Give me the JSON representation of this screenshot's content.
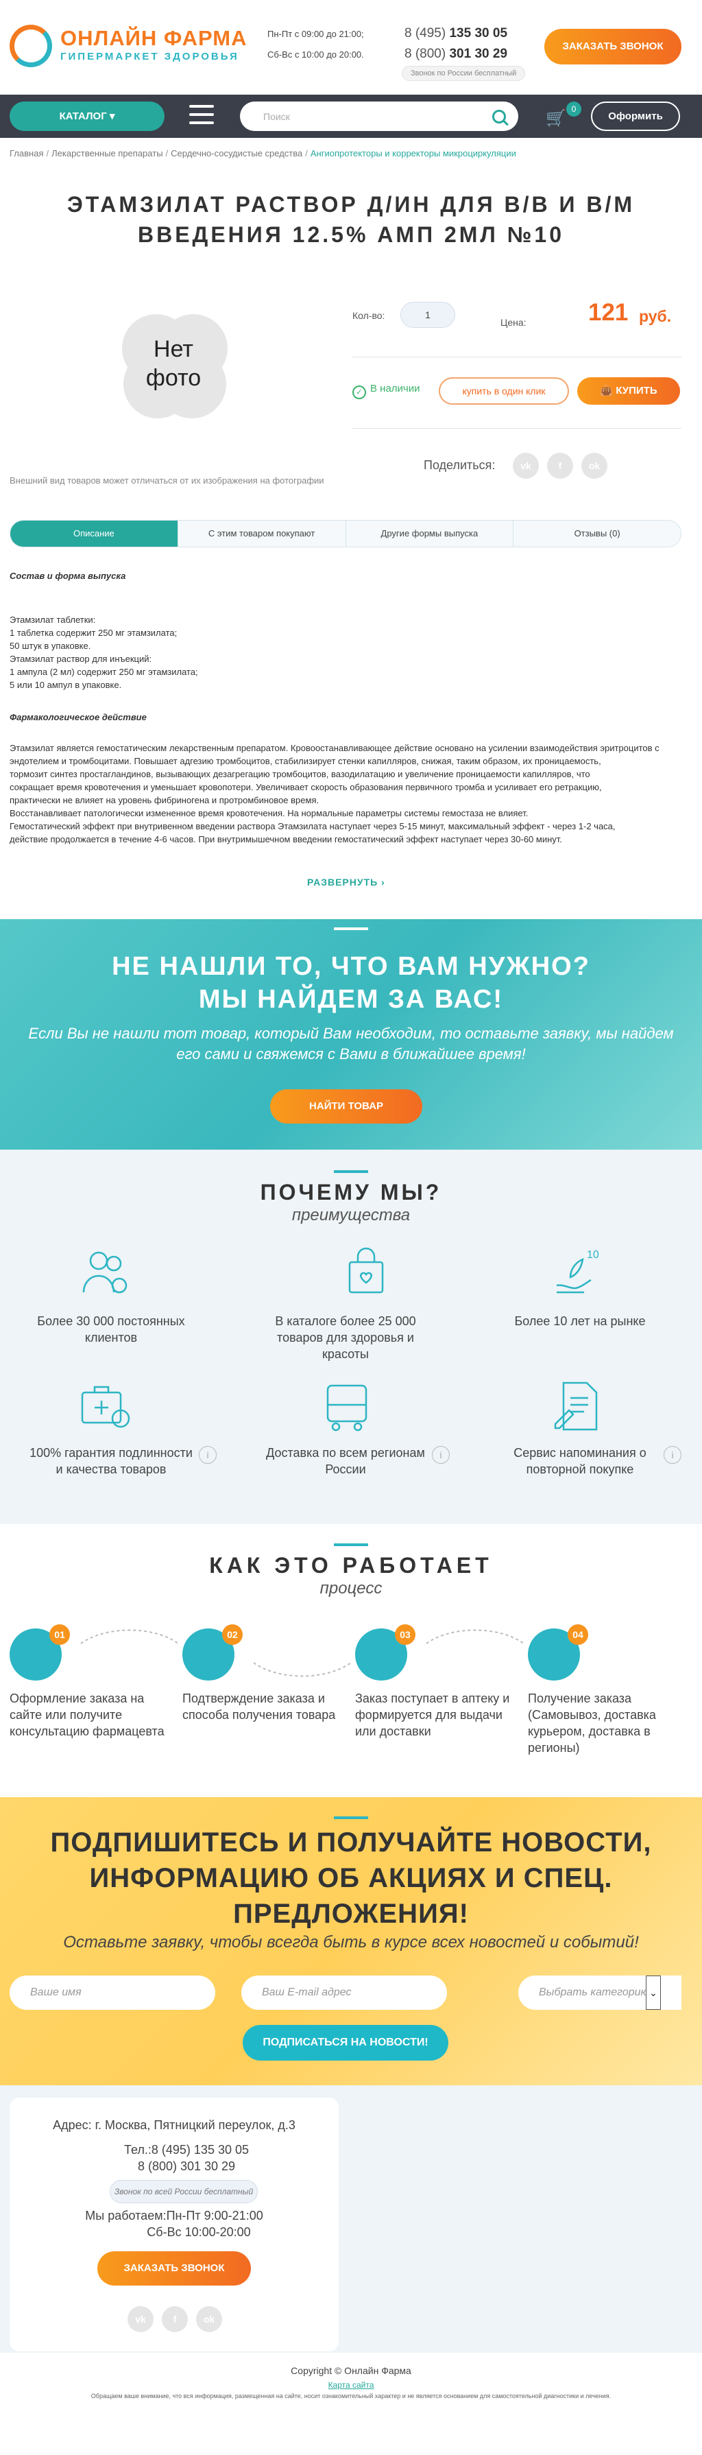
{
  "header": {
    "logo_title": "ОНЛАЙН ФАРМА",
    "logo_subtitle": "ГИПЕРМАРКЕТ ЗДОРОВЬЯ",
    "schedule_1": "Пн-Пт с 09:00 до 21:00;",
    "schedule_2": "Сб-Вс с 10:00 до 20:00.",
    "phone1_prefix": "8 (495)",
    "phone1_num": "135 30 05",
    "phone2_prefix": "8 (800)",
    "phone2_num": "301 30 29",
    "free_call": "Звонок по России бесплатный",
    "call_button": "ЗАКАЗАТЬ ЗВОНОК"
  },
  "nav": {
    "catalog": "КАТАЛОГ",
    "search_placeholder": "Поиск",
    "cart_count": "0",
    "checkout": "Оформить"
  },
  "breadcrumbs": [
    "Главная",
    "Лекарственные препараты",
    "Сердечно-сосудистые средства",
    "Ангиопротекторы и корректоры микроциркуляции"
  ],
  "product": {
    "title_line1": "ЭТАМЗИЛАТ РАСТВОР Д/ИН ДЛЯ В/В И В/М",
    "title_line2": "ВВЕДЕНИЯ 12.5% АМП 2МЛ №10",
    "no_photo_1": "Нет",
    "no_photo_2": "фото",
    "disclaimer": "Внешний вид товаров может отличаться от их изображения на фотографии",
    "qty_label": "Кол-во:",
    "qty": "1",
    "price_label": "Цена:",
    "price": "121",
    "price_unit": "руб.",
    "in_stock": "В наличии",
    "one_click": "купить в один клик",
    "buy": "КУПИТЬ",
    "share_label": "Поделиться:"
  },
  "social": [
    "vk",
    "f",
    "ok"
  ],
  "tabs": [
    "Описание",
    "С этим товаром покупают",
    "Другие формы выпуска",
    "Отзывы (0)"
  ],
  "description": {
    "h1": "Состав и форма выпуска",
    "lines1": [
      "Этамзилат таблетки:",
      "1 таблетка содержит 250 мг этамзилата;",
      "50 штук в упаковке.",
      "Этамзилат раствор для инъекций:",
      "1 ампула (2 мл) содержит 250 мг этамзилата;",
      "5 или 10 ампул в упаковке."
    ],
    "h2": "Фармакологическое действие",
    "lines2": [
      "Этамзилат является гемостатическим лекарственным препаратом. Кровоостанавливающее действие основано на усилении взаимодействия эритроцитов с",
      "эндотелием и тромбоцитами. Повышает адгезию тромбоцитов, стабилизирует стенки капилляров, снижая, таким образом, их проницаемость,",
      "тормозит синтез простагландинов, вызывающих дезагрегацию тромбоцитов, вазодилатацию и увеличение проницаемости капилляров, что",
      "сокращает время кровотечения и уменьшает кровопотери. Увеличивает скорость образования первичного тромба и усиливает его ретракцию,",
      "практически не влияет на уровень фибриногена и протромбиновое время.",
      "Восстанавливает патологически измененное время кровотечения. На нормальные параметры системы гемостаза не влияет.",
      "Гемостатический эффект при внутривенном введении раствора Этамзилата наступает через 5-15 минут, максимальный эффект - через 1-2 часа,",
      "действие продолжается в течение 4-6 часов. При внутримышечном введении гемостатический эффект наступает через 30-60 минут."
    ],
    "expand": "РАЗВЕРНУТЬ"
  },
  "banner": {
    "title1": "НЕ НАШЛИ ТО, ЧТО ВАМ НУЖНО?",
    "title2": "МЫ НАЙДЕМ ЗА ВАС!",
    "subtitle": "Если Вы не нашли тот товар, который Вам необходим, то оставьте заявку, мы найдем его сами и свяжемся с Вами в ближайшее время!",
    "button": "НАЙТИ ТОВАР"
  },
  "why": {
    "title": "ПОЧЕМУ МЫ?",
    "subtitle": "преимущества",
    "items": [
      {
        "text": "Более 30 000 постоянных клиентов",
        "icon": "clients-icon"
      },
      {
        "text": "В каталоге более 25 000 товаров для здоровья и красоты",
        "icon": "shopping-bag-icon"
      },
      {
        "text": "Более 10 лет на рынке",
        "icon": "ten-years-icon"
      },
      {
        "text": "100% гарантия подлинности и качества товаров",
        "icon": "medkit-icon"
      },
      {
        "text": "Доставка по всем регионам России",
        "icon": "bus-icon"
      },
      {
        "text": "Сервис напоминания о повторной покупке",
        "icon": "reminder-icon"
      }
    ]
  },
  "how": {
    "title": "КАК ЭТО РАБОТАЕТ",
    "subtitle": "процесс",
    "steps": [
      {
        "num": "01",
        "text": "Оформление заказа на сайте или получите консультацию фармацевта",
        "icon": "hand-icon"
      },
      {
        "num": "02",
        "text": "Подтверждение заказа и способа получения товара",
        "icon": "phone-icon"
      },
      {
        "num": "03",
        "text": "Заказ поступает в аптеку и формируется для выдачи или доставки",
        "icon": "box-icon"
      },
      {
        "num": "04",
        "text": "Получение заказа (Самовывоз, доставка курьером, доставка в регионы)",
        "icon": "truck-icon"
      }
    ]
  },
  "subscribe": {
    "title1": "ПОДПИШИТЕСЬ И ПОЛУЧАЙТЕ НОВОСТИ,",
    "title2": "ИНФОРМАЦИЮ ОБ АКЦИЯХ И СПЕЦ.",
    "title3": "ПРЕДЛОЖЕНИЯ!",
    "subtitle": "Оставьте заявку, чтобы всегда быть в курсе всех новостей и событий!",
    "name_placeholder": "Ваше имя",
    "email_placeholder": "Ваш E-mail адрес",
    "category": "Выбрать категорию",
    "button": "ПОДПИСАТЬСЯ НА НОВОСТИ!"
  },
  "footer": {
    "address": "Адрес: г. Москва, Пятницкий переулок, д.3",
    "phone1": "Тел.:8 (495) 135 30 05",
    "phone2": "8 (800) 301 30 29",
    "free_call": "Звонок по всей России бесплатный",
    "hours1": "Мы работаем:Пн-Пт 9:00-21:00",
    "hours2": "Сб-Вс 10:00-20:00",
    "call_button": "ЗАКАЗАТЬ ЗВОНОК",
    "copyright": "Copyright © Онлайн Фарма",
    "sitemap": "Карта сайта",
    "legal": "Обращаем ваше внимание, что вся информация, размещенная на сайте, носит ознакомительный характер и не является основанием для самостоятельной диагностики и лечения."
  },
  "colors": {
    "accent": "#26a89c",
    "orange": "#f26a22",
    "teal": "#2cb5c4",
    "dark": "#3a3f4a"
  }
}
